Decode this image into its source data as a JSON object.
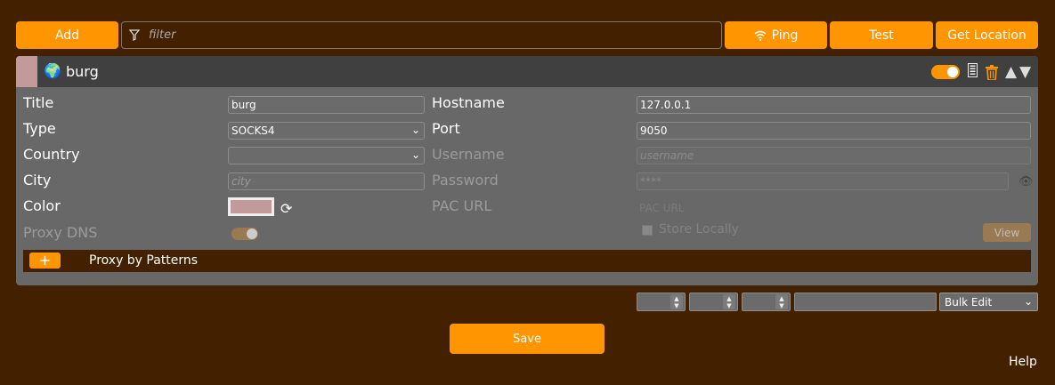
{
  "toolbar": {
    "add_label": "Add",
    "filter_placeholder": "filter",
    "ping_label": "Ping",
    "test_label": "Test",
    "get_location_label": "Get Location"
  },
  "proxy": {
    "name": "burg",
    "enabled": true,
    "color": "#c39a9a",
    "fields": {
      "title_label": "Title",
      "title_value": "burg",
      "type_label": "Type",
      "type_value": "SOCKS4",
      "country_label": "Country",
      "country_value": "",
      "city_label": "City",
      "city_placeholder": "city",
      "color_label": "Color",
      "proxy_dns_label": "Proxy DNS",
      "hostname_label": "Hostname",
      "hostname_value": "127.0.0.1",
      "port_label": "Port",
      "port_value": "9050",
      "username_label": "Username",
      "username_placeholder": "username",
      "password_label": "Password",
      "password_placeholder": "****",
      "pac_url_label": "PAC URL",
      "pac_url_placeholder": "PAC URL",
      "store_locally_label": "Store Locally",
      "view_label": "View"
    },
    "patterns": {
      "add_label": "+",
      "label": "Proxy by Patterns"
    }
  },
  "bulk": {
    "select_value": "Bulk Edit"
  },
  "footer": {
    "save_label": "Save",
    "help_label": "Help"
  },
  "colors": {
    "background": "#432000",
    "accent": "#ff9500",
    "panel": "#686868",
    "header": "#404040"
  }
}
